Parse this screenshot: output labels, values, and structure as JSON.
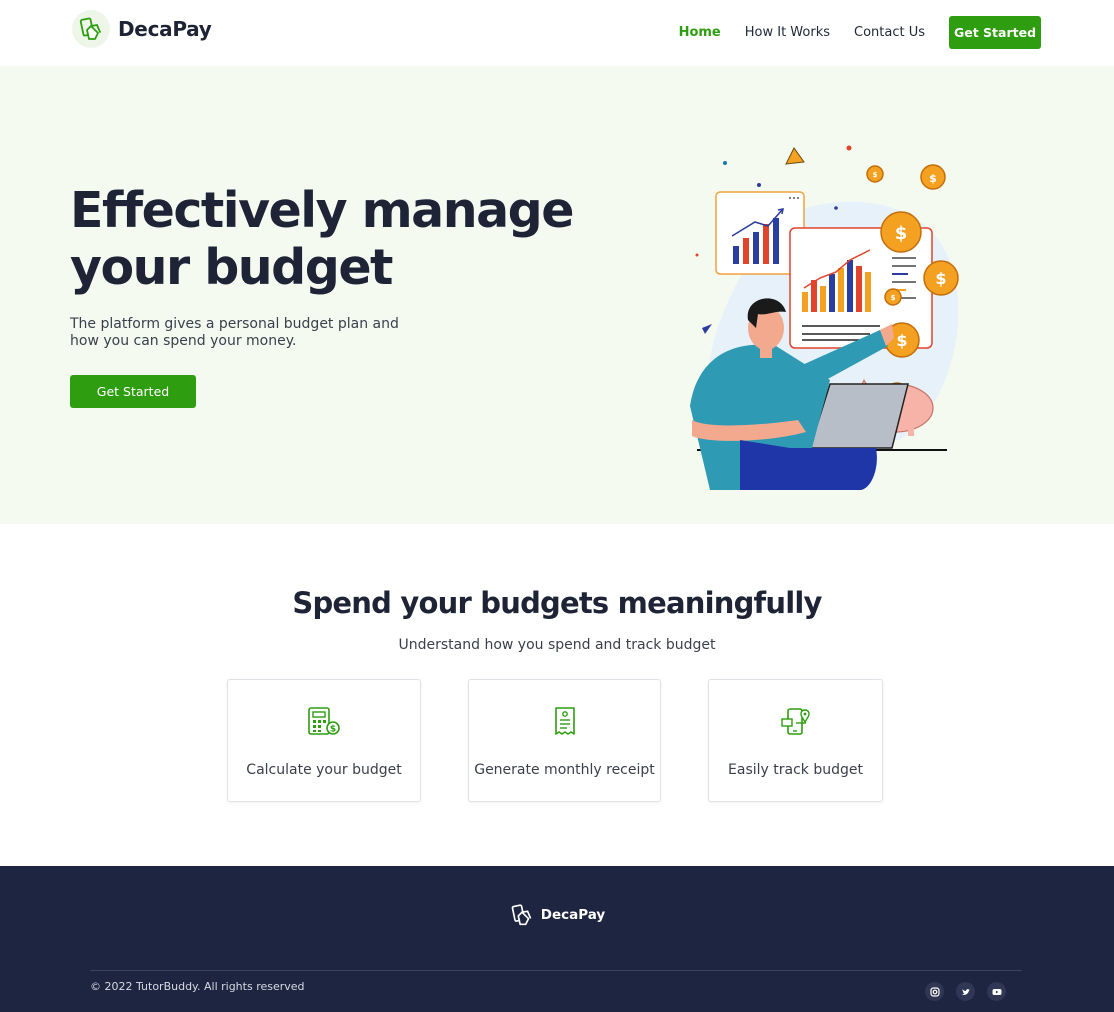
{
  "brand": {
    "name": "DecaPay"
  },
  "nav": {
    "items": [
      {
        "label": "Home",
        "active": true
      },
      {
        "label": "How It Works",
        "active": false
      },
      {
        "label": "Contact Us",
        "active": false
      }
    ],
    "cta_label": "Get Started"
  },
  "hero": {
    "title": "Effectively manage your budget",
    "subtitle": "The platform gives a personal budget plan and how you can spend your money.",
    "cta_label": "Get Started"
  },
  "features": {
    "title": "Spend your budgets meaningfully",
    "subtitle": "Understand how you spend and track budget",
    "cards": [
      {
        "label": "Calculate your budget",
        "icon": "calculator-icon"
      },
      {
        "label": "Generate monthly receipt",
        "icon": "receipt-icon"
      },
      {
        "label": "Easily track budget",
        "icon": "phone-tracking-icon"
      }
    ]
  },
  "footer": {
    "brand": "DecaPay",
    "copyright": "© 2022 TutorBuddy. All rights reserved",
    "social": [
      "instagram-icon",
      "twitter-icon",
      "youtube-icon"
    ]
  },
  "colors": {
    "accent": "#2e9d10",
    "dark": "#1e2436",
    "footer_bg": "#1e2540",
    "hero_bg": "#f5faf1"
  }
}
